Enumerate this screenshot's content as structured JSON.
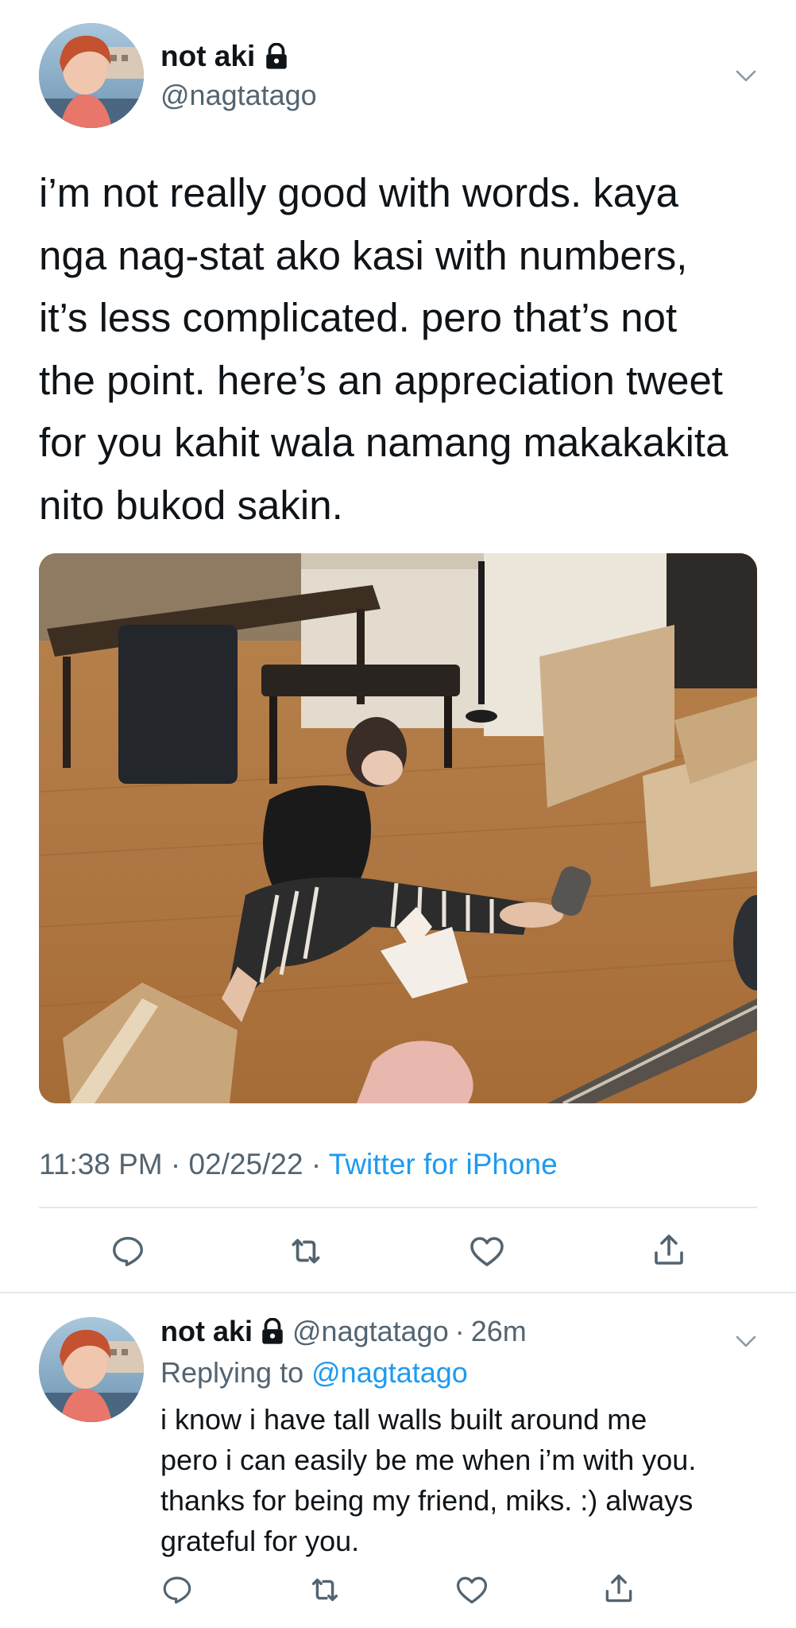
{
  "main_tweet": {
    "display_name": "not aki",
    "handle": "@nagtatago",
    "text": "i’m not really good with words. kaya\nnga nag-stat ako kasi with numbers,\nit’s less complicated. pero that’s not\nthe point. here’s an appreciation tweet\nfor you kahit wala namang makakakita\nnito bukod sakin.",
    "time": "11:38 PM",
    "separator": "·",
    "date": "02/25/22",
    "source": "Twitter for iPhone",
    "media_icon": "photo-of-person-sitting-on-floor"
  },
  "actions": {
    "reply_icon": "reply-icon",
    "retweet_icon": "retweet-icon",
    "like_icon": "heart-icon",
    "share_icon": "share-icon"
  },
  "reply_tweet": {
    "display_name": "not aki",
    "handle": "@nagtatago",
    "separator": "·",
    "time_ago": "26m",
    "replying_prefix": "Replying to",
    "replying_to": "@nagtatago",
    "text": "i know i have tall walls built around me\npero i can easily be me when i’m with you.\nthanks for being my friend, miks. :) always\ngrateful for you."
  },
  "colors": {
    "text": "#0f1419",
    "secondary": "#536471",
    "link": "#1d9bf0",
    "divider": "#e4e8eb"
  }
}
